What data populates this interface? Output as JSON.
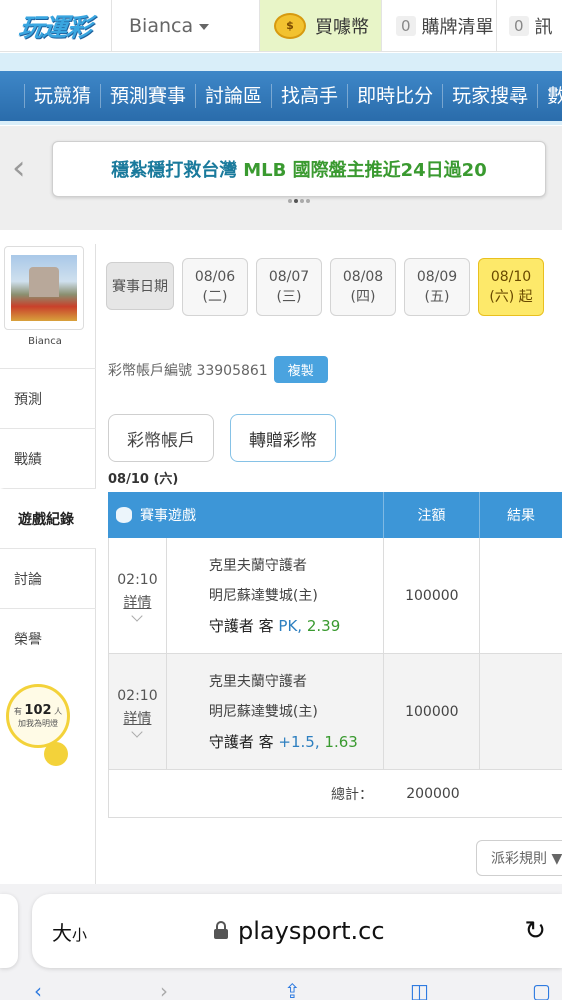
{
  "header": {
    "logo": "玩運彩",
    "user": "Bianca",
    "buy_coin": "買噱幣",
    "cart_count": "0",
    "cart": "購牌清單",
    "msg_count": "0",
    "msg": "訊"
  },
  "nav": {
    "items": [
      "玩競猜",
      "預測賽事",
      "討論區",
      "找高手",
      "即時比分",
      "玩家搜尋",
      "數"
    ]
  },
  "banner": {
    "text_part1": "穩紮穩打救台灣",
    "text_part2": "MLB 國際盤主推近24日過20"
  },
  "sidebar": {
    "avatar_name": "Bianca",
    "items": [
      "預測",
      "戰績",
      "遊戲紀錄",
      "討論",
      "榮譽"
    ],
    "fans_prefix": "有",
    "fans_count": "102",
    "fans_unit": "人",
    "fans_caption": "加我為明燈"
  },
  "dates": {
    "label": "賽事日期",
    "buttons": [
      {
        "date": "08/06",
        "day": "(二)"
      },
      {
        "date": "08/07",
        "day": "(三)"
      },
      {
        "date": "08/08",
        "day": "(四)"
      },
      {
        "date": "08/09",
        "day": "(五)"
      },
      {
        "date": "08/10",
        "day": "(六) 起"
      }
    ]
  },
  "account": {
    "label": "彩幣帳戶編號 33905861",
    "copy": "複製"
  },
  "tabs": [
    "彩幣帳戶",
    "轉贈彩幣"
  ],
  "current_date": "08/10 (六)",
  "table": {
    "headers": {
      "game": "賽事遊戲",
      "bet": "注額",
      "result": "結果"
    },
    "rows": [
      {
        "time": "02:10",
        "detail": "詳情",
        "away": "克里夫蘭守護者",
        "home": "明尼蘇達雙城(主)",
        "pick_team": "守護者 客",
        "pick_line": "PK,",
        "pick_odds": "2.39",
        "bet": "100000",
        "result": ""
      },
      {
        "time": "02:10",
        "detail": "詳情",
        "away": "克里夫蘭守護者",
        "home": "明尼蘇達雙城(主)",
        "pick_team": "守護者 客",
        "pick_line": "+1.5,",
        "pick_odds": "1.63",
        "bet": "100000",
        "result": ""
      }
    ],
    "total_label": "總計：",
    "total_value": "200000"
  },
  "rules_button": "派彩規則 ▼",
  "browser": {
    "text_size": "大",
    "text_size_small": "小",
    "url": "playsport.cc",
    "reload": "↻"
  },
  "colors": {
    "nav_blue": "#2a6cab",
    "table_header": "#3d96d7",
    "active_date": "#fde96a",
    "odds_green": "#3a9a30",
    "line_blue": "#2d7fc0"
  }
}
